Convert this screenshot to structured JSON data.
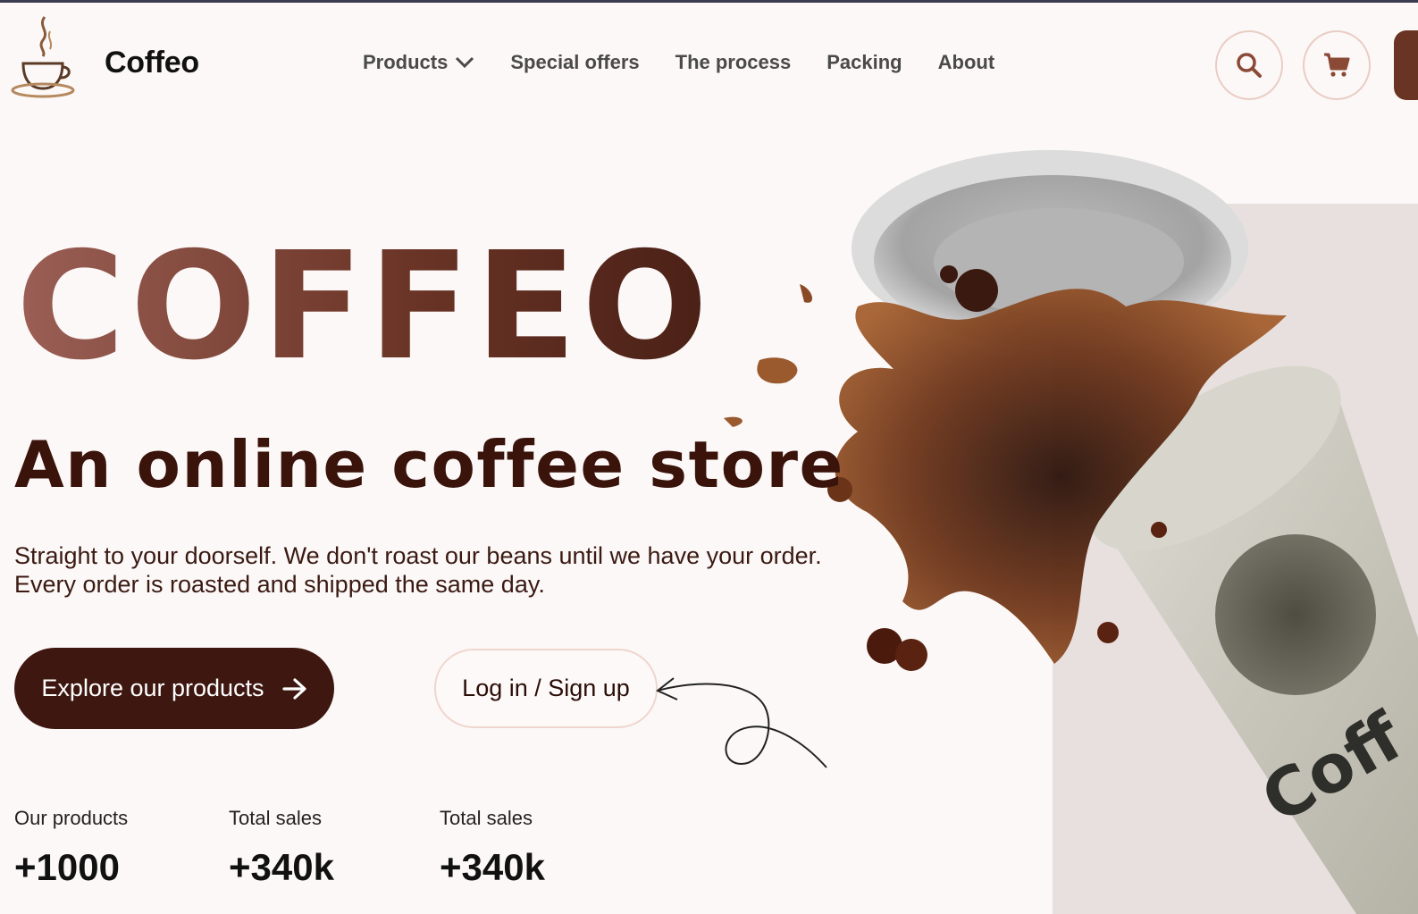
{
  "header": {
    "brand": "Coffeo",
    "nav": [
      {
        "label": "Products",
        "has_dropdown": true
      },
      {
        "label": "Special offers"
      },
      {
        "label": "The process"
      },
      {
        "label": "Packing"
      },
      {
        "label": "About"
      }
    ],
    "search_icon": "search-icon",
    "cart_icon": "cart-icon"
  },
  "hero": {
    "title": "COFFEO",
    "subtitle": "An online coffee store",
    "description_line1": "Straight to your doorself. We don't roast our beans until we have your order.",
    "description_line2": "Every order is roasted and shipped the same day.",
    "primary_button": "Explore our products",
    "secondary_button": "Log in / Sign up",
    "cup_text": "Coff"
  },
  "stats": [
    {
      "label": "Our products",
      "value": "+1000"
    },
    {
      "label": "Total sales",
      "value": "+340k"
    },
    {
      "label": "Total sales",
      "value": "+340k"
    }
  ],
  "colors": {
    "background": "#fcf8f7",
    "primary": "#3e1710",
    "accent": "#6a3424",
    "border": "#e9cdc4"
  }
}
